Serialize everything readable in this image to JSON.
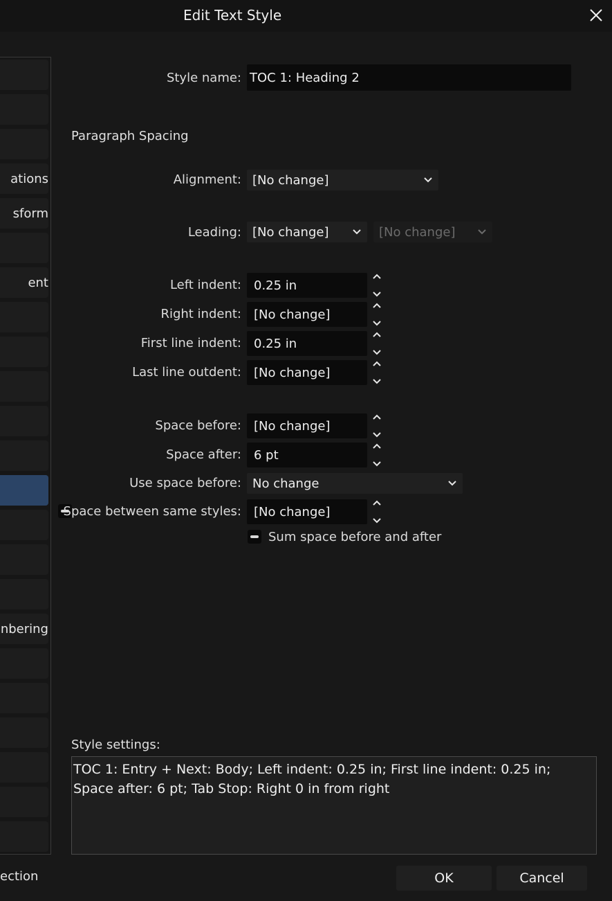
{
  "dialog": {
    "title": "Edit Text Style"
  },
  "sidebar": {
    "items": [
      {
        "label": ""
      },
      {
        "label": ""
      },
      {
        "label": ""
      },
      {
        "label": "ations"
      },
      {
        "label": "sform"
      },
      {
        "label": ""
      },
      {
        "label": "ent"
      },
      {
        "label": ""
      },
      {
        "label": ""
      },
      {
        "label": ""
      },
      {
        "label": ""
      },
      {
        "label": ""
      },
      {
        "label": ""
      },
      {
        "label": ""
      },
      {
        "label": ""
      },
      {
        "label": ""
      },
      {
        "label": "nbering"
      },
      {
        "label": ""
      },
      {
        "label": ""
      },
      {
        "label": ""
      },
      {
        "label": ""
      },
      {
        "label": ""
      },
      {
        "label": ""
      }
    ],
    "footer": "ection"
  },
  "style_name": {
    "label": "Style name:",
    "value": "TOC 1: Heading 2"
  },
  "section_title": "Paragraph Spacing",
  "alignment": {
    "label": "Alignment:",
    "value": "[No change]"
  },
  "leading": {
    "label": "Leading:",
    "value": "[No change]",
    "secondary": "[No change]"
  },
  "left_indent": {
    "label": "Left indent:",
    "value": "0.25 in"
  },
  "right_indent": {
    "label": "Right indent:",
    "value": "[No change]"
  },
  "first_line_indent": {
    "label": "First line indent:",
    "value": "0.25 in"
  },
  "last_line_outdent": {
    "label": "Last line outdent:",
    "value": "[No change]"
  },
  "space_before": {
    "label": "Space before:",
    "value": "[No change]"
  },
  "space_after": {
    "label": "Space after:",
    "value": "6 pt"
  },
  "use_space_before": {
    "label": "Use space before:",
    "value": "No change"
  },
  "space_between_same": {
    "label": "Space between same styles:",
    "value": "[No change]"
  },
  "sum_space": {
    "label": "Sum space before and after"
  },
  "style_settings": {
    "label": "Style settings:",
    "text": "TOC 1: Entry + Next: Body; Left indent: 0.25 in; First line indent: 0.25 in; Space after: 6 pt; Tab Stop: Right 0 in from right"
  },
  "buttons": {
    "ok": "OK",
    "cancel": "Cancel"
  },
  "colors": {
    "background": "#181818",
    "field": "#0b0b0b",
    "selected": "#2b4466"
  }
}
